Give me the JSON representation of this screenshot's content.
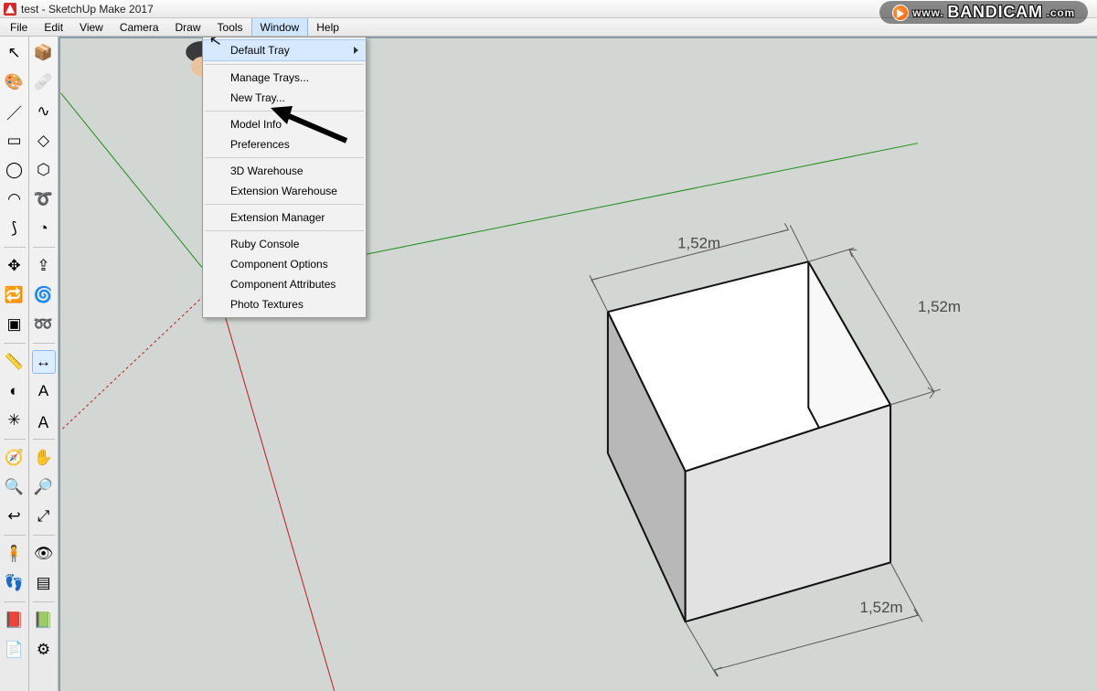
{
  "title": "test - SketchUp Make 2017",
  "watermark": {
    "www": "www.",
    "brand": "BANDICAM",
    "dotcom": ".com"
  },
  "menu": {
    "items": [
      {
        "id": "file",
        "label": "File"
      },
      {
        "id": "edit",
        "label": "Edit"
      },
      {
        "id": "view",
        "label": "View"
      },
      {
        "id": "camera",
        "label": "Camera"
      },
      {
        "id": "draw",
        "label": "Draw"
      },
      {
        "id": "tools",
        "label": "Tools"
      },
      {
        "id": "window",
        "label": "Window"
      },
      {
        "id": "help",
        "label": "Help"
      }
    ]
  },
  "window_menu": {
    "items": [
      {
        "id": "default-tray",
        "label": "Default Tray",
        "submenu": true,
        "highlight": true
      },
      {
        "sep": true
      },
      {
        "id": "manage-trays",
        "label": "Manage Trays..."
      },
      {
        "id": "new-tray",
        "label": "New Tray..."
      },
      {
        "sep": true
      },
      {
        "id": "model-info",
        "label": "Model Info"
      },
      {
        "id": "preferences",
        "label": "Preferences"
      },
      {
        "sep": true
      },
      {
        "id": "3d-warehouse",
        "label": "3D Warehouse"
      },
      {
        "id": "extension-warehouse",
        "label": "Extension Warehouse"
      },
      {
        "sep": true
      },
      {
        "id": "extension-manager",
        "label": "Extension Manager"
      },
      {
        "sep": true
      },
      {
        "id": "ruby-console",
        "label": "Ruby Console"
      },
      {
        "id": "component-options",
        "label": "Component Options"
      },
      {
        "id": "component-attributes",
        "label": "Component Attributes"
      },
      {
        "id": "photo-textures",
        "label": "Photo Textures"
      }
    ]
  },
  "toolbar_left": [
    {
      "id": "select",
      "glyph": "↖",
      "name": "select-tool"
    },
    {
      "id": "component",
      "glyph": "📦",
      "name": "make-component-tool"
    },
    {
      "id": "paint",
      "glyph": "🎨",
      "name": "paint-bucket-tool"
    },
    {
      "id": "eraser",
      "glyph": "🩹",
      "name": "eraser-tool"
    },
    {
      "id": "line",
      "glyph": "／",
      "name": "line-tool"
    },
    {
      "id": "freehand",
      "glyph": "∿",
      "name": "freehand-tool"
    },
    {
      "id": "rectangle",
      "glyph": "▭",
      "name": "rectangle-tool"
    },
    {
      "id": "rotated-rect",
      "glyph": "◇",
      "name": "rotated-rectangle-tool"
    },
    {
      "id": "circle",
      "glyph": "◯",
      "name": "circle-tool"
    },
    {
      "id": "polygon",
      "glyph": "⬡",
      "name": "polygon-tool"
    },
    {
      "id": "arc",
      "glyph": "◠",
      "name": "arc-tool"
    },
    {
      "id": "arc2",
      "glyph": "➰",
      "name": "2pt-arc-tool"
    },
    {
      "id": "arc3",
      "glyph": "⟆",
      "name": "3pt-arc-tool"
    },
    {
      "id": "pie",
      "glyph": "◔",
      "name": "pie-tool"
    },
    {
      "sep": true
    },
    {
      "id": "move",
      "glyph": "✥",
      "name": "move-tool"
    },
    {
      "id": "pushpull",
      "glyph": "⇪",
      "name": "pushpull-tool"
    },
    {
      "id": "rotate",
      "glyph": "🔁",
      "name": "rotate-tool"
    },
    {
      "id": "followme",
      "glyph": "🌀",
      "name": "followme-tool"
    },
    {
      "id": "scale",
      "glyph": "▣",
      "name": "scale-tool"
    },
    {
      "id": "offset",
      "glyph": "➿",
      "name": "offset-tool"
    },
    {
      "sep": true
    },
    {
      "id": "tape",
      "glyph": "📏",
      "name": "tape-measure-tool"
    },
    {
      "id": "dimension",
      "glyph": "↔",
      "name": "dimension-tool",
      "active": true
    },
    {
      "id": "protractor",
      "glyph": "◐",
      "name": "protractor-tool"
    },
    {
      "id": "text",
      "glyph": "A",
      "name": "text-tool"
    },
    {
      "id": "axes",
      "glyph": "✳",
      "name": "axes-tool"
    },
    {
      "id": "3dtext",
      "glyph": "Ａ",
      "name": "3d-text-tool"
    },
    {
      "sep": true
    },
    {
      "id": "orbit",
      "glyph": "🧭",
      "name": "orbit-tool"
    },
    {
      "id": "pan",
      "glyph": "✋",
      "name": "pan-tool"
    },
    {
      "id": "zoom",
      "glyph": "🔍",
      "name": "zoom-tool"
    },
    {
      "id": "zoomwin",
      "glyph": "🔎",
      "name": "zoom-window-tool"
    },
    {
      "id": "prevview",
      "glyph": "↩",
      "name": "previous-view-tool"
    },
    {
      "id": "zoomext",
      "glyph": "⤢",
      "name": "zoom-extents-tool"
    },
    {
      "sep": true
    },
    {
      "id": "position-cam",
      "glyph": "🧍",
      "name": "position-camera-tool"
    },
    {
      "id": "lookaround",
      "glyph": "👁",
      "name": "look-around-tool"
    },
    {
      "id": "walk",
      "glyph": "👣",
      "name": "walk-tool"
    },
    {
      "id": "section",
      "glyph": "▤",
      "name": "section-plane-tool"
    },
    {
      "sep": true
    },
    {
      "id": "warehouse",
      "glyph": "📕",
      "name": "3d-warehouse-tool"
    },
    {
      "id": "extwarehouse",
      "glyph": "📗",
      "name": "extension-warehouse-tool"
    },
    {
      "id": "sendlayout",
      "glyph": "📄",
      "name": "send-to-layout-tool"
    },
    {
      "id": "extmgr",
      "glyph": "⚙",
      "name": "extension-manager-tool"
    }
  ],
  "dimensions": {
    "top": "1,52m",
    "right": "1,52m",
    "bottom": "1,52m"
  }
}
